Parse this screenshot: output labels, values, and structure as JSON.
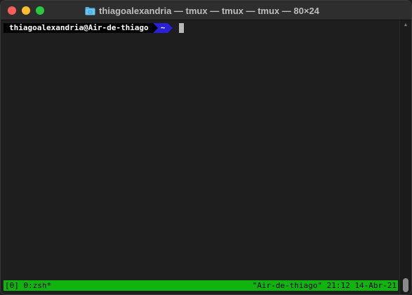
{
  "window": {
    "title": "thiagoalexandria — tmux — tmux — tmux — 80×24",
    "icon": "folder-icon",
    "controls": [
      "close",
      "minimize",
      "zoom"
    ]
  },
  "prompt": {
    "user_host": "thiagoalexandria@Air-de-thiago",
    "directory": "~",
    "colors": {
      "host_bg": "#000000",
      "dir_bg": "#2a20d8",
      "text": "#ffffff"
    }
  },
  "tmux_status": {
    "left": "[0] 0:zsh*",
    "right": "\"Air-de-thiago\" 21:12 14-Abr-21",
    "bg_color": "#11b30e"
  },
  "colors": {
    "terminal_bg": "#1e1e1e",
    "titlebar_bg": "#2e2e2e",
    "close": "#ff5f57",
    "minimize": "#febc2e",
    "zoom": "#28c840"
  }
}
